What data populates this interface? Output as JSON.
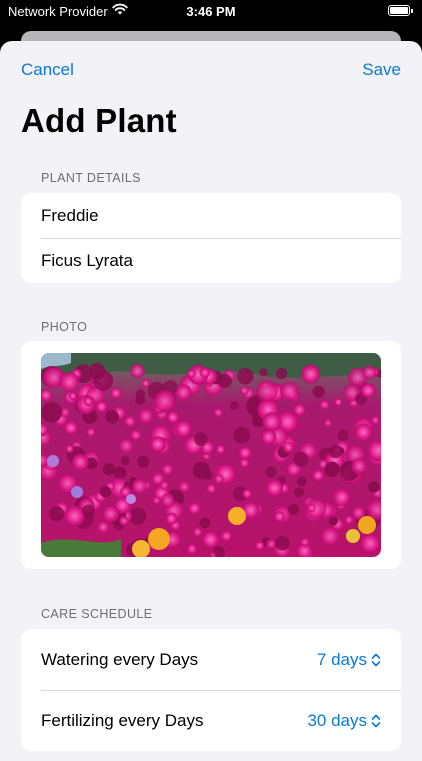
{
  "status_bar": {
    "carrier": "Network Provider",
    "time": "3:46 PM",
    "battery_level": 1.0
  },
  "nav": {
    "cancel_label": "Cancel",
    "save_label": "Save"
  },
  "title": "Add Plant",
  "plant_details": {
    "header": "PLANT DETAILS",
    "name": "Freddie",
    "species": "Ficus Lyrata"
  },
  "photo": {
    "header": "PHOTO"
  },
  "care_schedule": {
    "header": "CARE SCHEDULE",
    "rows": [
      {
        "label": "Watering every  Days",
        "value": "7 days"
      },
      {
        "label": "Fertilizing every  Days",
        "value": "30 days"
      }
    ]
  },
  "colors": {
    "accent": "#0a7ad6",
    "background": "#f2f2f7"
  },
  "icons": [
    "wifi-icon",
    "battery-icon",
    "chevron-up-down-icon"
  ]
}
